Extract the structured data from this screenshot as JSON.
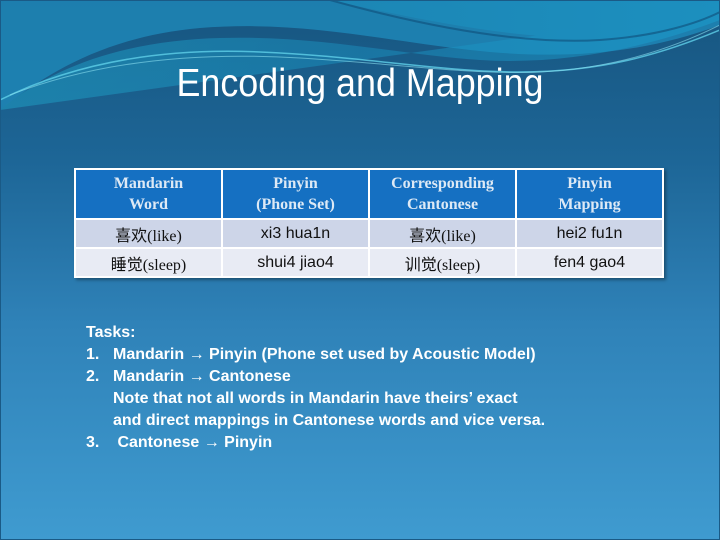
{
  "slide": {
    "title": "Encoding and Mapping"
  },
  "table": {
    "headers": [
      [
        "Mandarin",
        "Word"
      ],
      [
        "Pinyin",
        "(Phone Set)"
      ],
      [
        "Corresponding",
        "Cantonese"
      ],
      [
        "Pinyin",
        "Mapping"
      ]
    ],
    "rows": [
      [
        "喜欢(like)",
        "xi3 hua1n",
        "喜欢(like)",
        "hei2 fu1n"
      ],
      [
        "睡觉(sleep)",
        "shui4 jiao4",
        "训觉(sleep)",
        "fen4 gao4"
      ]
    ]
  },
  "tasks": {
    "heading": "Tasks:",
    "arrow_icon": "→",
    "items": [
      {
        "num": "1.",
        "from": "Mandarin",
        "to": "Pinyin (Phone set used by Acoustic Model)"
      },
      {
        "num": "2.",
        "from": "Mandarin",
        "to": "Cantonese"
      },
      {
        "num": "3.",
        "from": "Cantonese",
        "to": "Pinyin"
      }
    ],
    "note_line1": "Note that not all words in Mandarin have theirs’ exact",
    "note_line2": "and direct mappings in Cantonese words and vice versa."
  },
  "colors": {
    "header_bg": "#1570c2",
    "row1_bg": "#cdd5e8",
    "row2_bg": "#e8ebf4"
  }
}
